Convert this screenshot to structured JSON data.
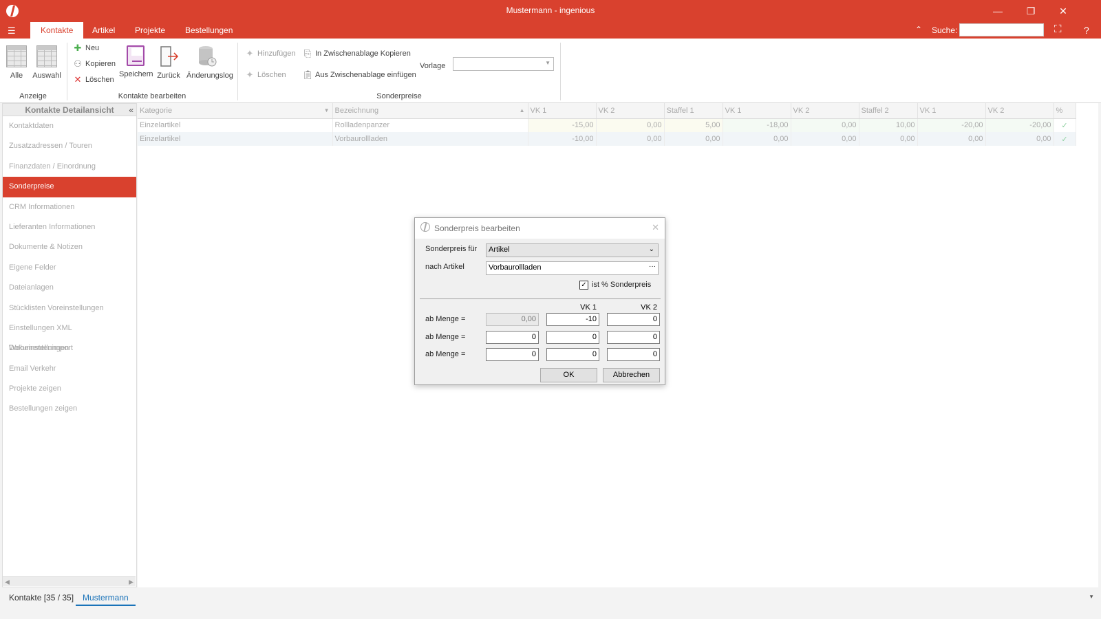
{
  "window": {
    "title": "Mustermann - ingenious",
    "minimize": "—",
    "restore": "❐",
    "close": "✕"
  },
  "menu": {
    "file_icon": "☰",
    "tabs": [
      "Kontakte",
      "Artikel",
      "Projekte",
      "Bestellungen"
    ],
    "active_tab": "Kontakte",
    "collapse_icon": "⌃",
    "search_label": "Suche:",
    "search_value": "",
    "binoculars_icon": "⛶",
    "help": "?"
  },
  "ribbon": {
    "anzeige": {
      "caption": "Anzeige",
      "alle": "Alle",
      "auswahl": "Auswahl"
    },
    "bearbeiten": {
      "caption": "Kontakte bearbeiten",
      "neu": "Neu",
      "kopieren": "Kopieren",
      "loeschen": "Löschen",
      "speichern": "Speichern",
      "zurueck": "Zurück",
      "aenderungslog": "Änderungslog"
    },
    "sonderpreise": {
      "caption": "Sonderpreise",
      "hinzufuegen": "Hinzufügen",
      "loeschen": "Löschen",
      "kopieren": "In Zwischenablage Kopieren",
      "einfuegen": "Aus Zwischenablage einfügen",
      "vorlage_label": "Vorlage",
      "vorlage_value": ""
    }
  },
  "sidebar": {
    "header": "Kontakte Detailansicht",
    "collapse": "«",
    "items": [
      "Kontaktdaten",
      "Zusatzadressen / Touren",
      "Finanzdaten / Einordnung",
      "Sonderpreise",
      "CRM Informationen",
      "Lieferanten Informationen",
      "Dokumente & Notizen",
      "Eigene Felder",
      "Dateianlagen",
      "Stücklisten Voreinstellungen",
      "Einstellungen XML Dokumentenimport",
      "Webeinstellungen",
      "Email Verkehr",
      "Projekte zeigen",
      "Bestellungen zeigen"
    ],
    "active": "Sonderpreise"
  },
  "grid": {
    "columns": [
      "Kategorie",
      "Bezeichnung",
      "VK 1",
      "VK 2",
      "Staffel 1",
      "VK 1",
      "VK 2",
      "Staffel 2",
      "VK 1",
      "VK 2",
      "%"
    ],
    "rows": [
      [
        "Einzelartikel",
        "Rollladenpanzer",
        "-15,00",
        "0,00",
        "5,00",
        "-18,00",
        "0,00",
        "10,00",
        "-20,00",
        "-20,00",
        "✓"
      ],
      [
        "Einzelartikel",
        "Vorbaurollladen",
        "-10,00",
        "0,00",
        "0,00",
        "0,00",
        "0,00",
        "0,00",
        "0,00",
        "0,00",
        "✓"
      ]
    ]
  },
  "statusbar": {
    "tabs": [
      "Kontakte [35 / 35]",
      "Mustermann"
    ],
    "active": "Mustermann",
    "dropdown": "▼"
  },
  "dialog": {
    "title": "Sonderpreis bearbeiten",
    "close": "✕",
    "sonderpreis_fuer_label": "Sonderpreis für",
    "sonderpreis_fuer_value": "Artikel",
    "nach_artikel_label": "nach Artikel",
    "nach_artikel_value": "Vorbaurollladen",
    "browse": "···",
    "prozent_label": "ist % Sonderpreis",
    "prozent_checked": "✓",
    "col_vk1": "VK 1",
    "col_vk2": "VK 2",
    "rows": [
      {
        "label": "ab Menge =",
        "menge": "0,00",
        "vk1": "-10",
        "vk2": "0"
      },
      {
        "label": "ab Menge =",
        "menge": "0",
        "vk1": "0",
        "vk2": "0"
      },
      {
        "label": "ab Menge =",
        "menge": "0",
        "vk1": "0",
        "vk2": "0"
      }
    ],
    "ok": "OK",
    "cancel": "Abbrechen"
  }
}
